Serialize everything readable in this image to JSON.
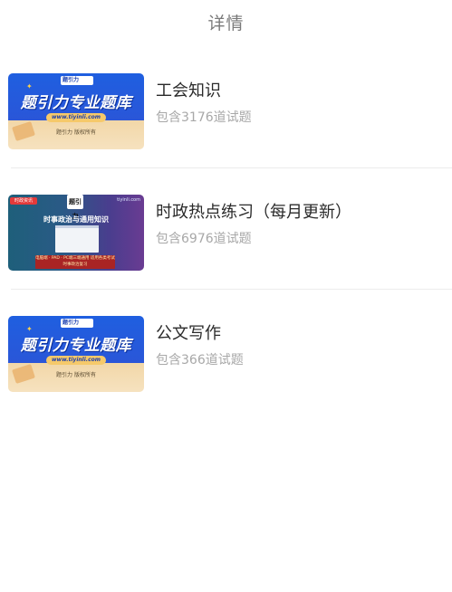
{
  "header": {
    "title": "详情"
  },
  "items": [
    {
      "title": "工会知识",
      "subtitle": "包含3176道试题",
      "thumb": {
        "style": "blue",
        "logo": "题引力",
        "headline": "题引力专业题库",
        "url": "www.tiyinli.com",
        "footer": "题引力 版权所有"
      }
    },
    {
      "title": "时政热点练习（每月更新）",
      "subtitle": "包含6976道试题",
      "thumb": {
        "style": "purple",
        "tag": "时政资讯",
        "site": "tiyinli.com",
        "logo": "题引力",
        "headline": "时事政治与通用知识",
        "band": "电脑端 · PAD · PC端三端通用 适用各类考试时事政治复习"
      }
    },
    {
      "title": "公文写作",
      "subtitle": "包含366道试题",
      "thumb": {
        "style": "blue",
        "logo": "题引力",
        "headline": "题引力专业题库",
        "url": "www.tiyinli.com",
        "footer": "题引力 版权所有"
      }
    }
  ],
  "colors": {
    "title": "#2a2a2a",
    "subtitle": "#a8a8a8",
    "header": "#7a7a7a",
    "divider": "#ececec",
    "banner_blue": "#1f5fe0"
  }
}
